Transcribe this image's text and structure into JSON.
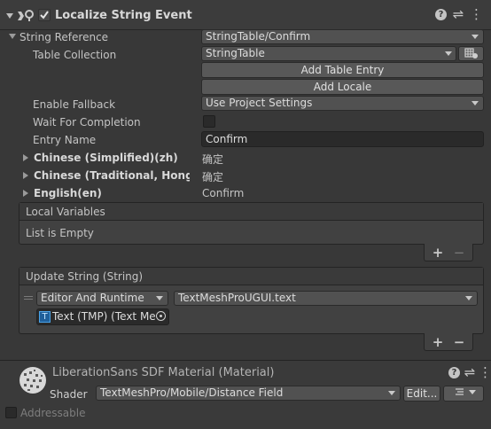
{
  "component": {
    "title": "Localize String Event",
    "enabled": true,
    "help_icon": "?",
    "preset_icon": "⇌",
    "menu_icon": "⋮"
  },
  "string_reference": {
    "label": "String Reference",
    "value": "StringTable/Confirm",
    "table_collection_label": "Table Collection",
    "table_collection_value": "StringTable",
    "add_table_entry": "Add Table Entry",
    "add_locale": "Add Locale",
    "enable_fallback_label": "Enable Fallback",
    "enable_fallback_value": "Use Project Settings",
    "wait_for_completion_label": "Wait For Completion",
    "wait_for_completion_checked": false,
    "entry_name_label": "Entry Name",
    "entry_name_value": "Confirm",
    "locales": [
      {
        "name": "Chinese (Simplified)(zh)",
        "value": "确定"
      },
      {
        "name": "Chinese (Traditional, Hong Ko",
        "value": "确定"
      },
      {
        "name": "English(en)",
        "value": "Confirm"
      }
    ]
  },
  "local_variables": {
    "title": "Local Variables",
    "empty_text": "List is Empty",
    "add": "+",
    "remove": "−"
  },
  "update_string": {
    "title": "Update String (String)",
    "runtime_value": "Editor And Runtime",
    "function_value": "TextMeshProUGUI.text",
    "target_value": "Text (TMP) (Text Me",
    "target_icon": "T",
    "add": "+",
    "remove": "−"
  },
  "material": {
    "title": "LiberationSans SDF Material (Material)",
    "shader_label": "Shader",
    "shader_value": "TextMeshPro/Mobile/Distance Field",
    "edit_button": "Edit...",
    "addressable_label": "Addressable"
  },
  "colors": {
    "background": "#383838",
    "field": "#515151",
    "text_field": "#2a2a2a",
    "button": "#585858",
    "panel": "#414141",
    "accent_icon": "#4aa3e8"
  }
}
